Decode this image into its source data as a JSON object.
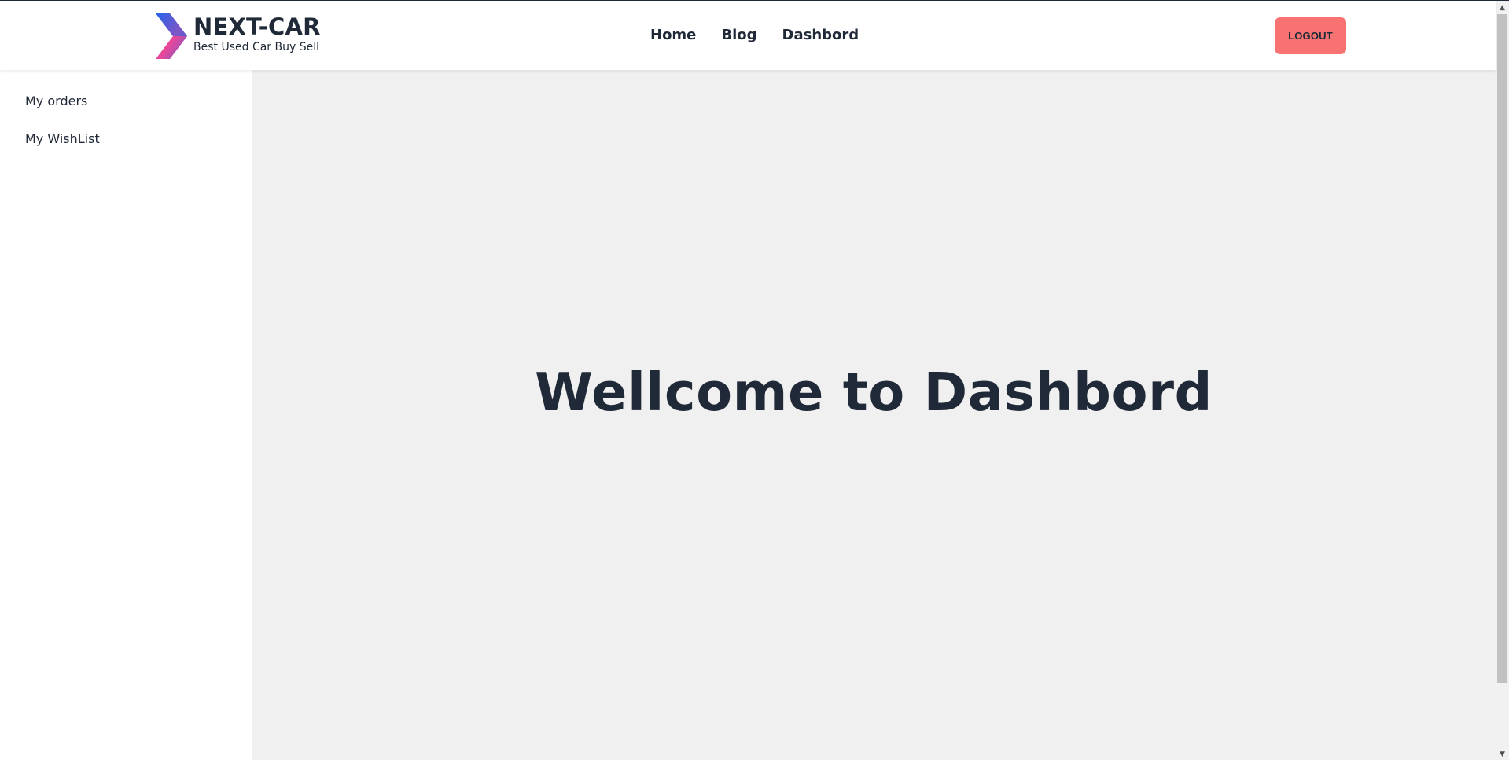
{
  "brand": {
    "name": "NEXT-CAR",
    "tagline": "Best Used Car Buy Sell",
    "logo_colors": [
      "#2563eb",
      "#ec4899"
    ]
  },
  "nav": {
    "links": [
      "Home",
      "Blog",
      "Dashbord"
    ]
  },
  "header": {
    "logout_label": "LOGOUT",
    "logout_color": "#f87272"
  },
  "sidebar": {
    "items": [
      "My orders",
      "My WishList"
    ]
  },
  "main": {
    "heading": "Wellcome to Dashbord",
    "background": "#f0f0f0"
  },
  "icons": [
    "chevron-up-icon",
    "chevron-down-icon"
  ]
}
